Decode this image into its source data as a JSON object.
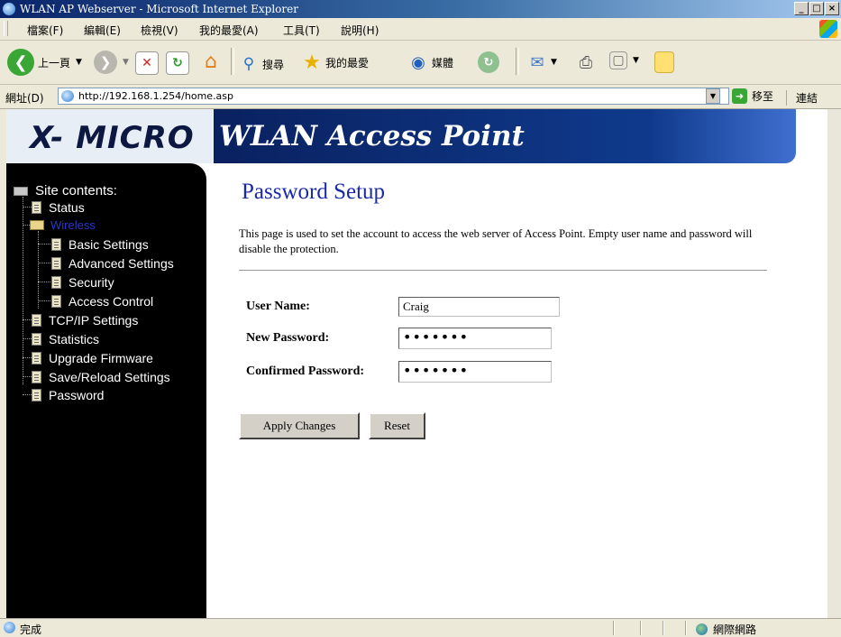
{
  "window": {
    "title": "WLAN AP Webserver - Microsoft Internet Explorer",
    "controls": [
      "_",
      "□",
      "×"
    ]
  },
  "menu": [
    "檔案(F)",
    "編輯(E)",
    "檢視(V)",
    "我的最愛(A)",
    "工具(T)",
    "說明(H)"
  ],
  "toolbar": {
    "back": "上一頁",
    "search": "搜尋",
    "favorites": "我的最愛",
    "media": "媒體"
  },
  "address": {
    "label": "網址(D)",
    "url": "http://192.168.1.254/home.asp",
    "go": "移至",
    "links": "連結"
  },
  "banner": {
    "logo": "X- MICRO",
    "product": "WLAN Access Point"
  },
  "sidebar": {
    "root": "Site contents:",
    "items": [
      {
        "label": "Status"
      },
      {
        "label": "Wireless"
      },
      {
        "label": "Basic Settings"
      },
      {
        "label": "Advanced Settings"
      },
      {
        "label": "Security"
      },
      {
        "label": "Access Control"
      },
      {
        "label": "TCP/IP Settings"
      },
      {
        "label": "Statistics"
      },
      {
        "label": "Upgrade Firmware"
      },
      {
        "label": "Save/Reload Settings"
      },
      {
        "label": "Password"
      }
    ]
  },
  "main": {
    "title": "Password Setup",
    "description": "This page is used to set the account to access the web server of Access Point. Empty user name and password will disable the protection.",
    "fields": {
      "user_name": {
        "label": "User Name:",
        "value": "Craig"
      },
      "new_password": {
        "label": "New Password:",
        "value": "•••••••"
      },
      "confirmed_password": {
        "label": "Confirmed Password:",
        "value": "•••••••"
      }
    },
    "buttons": {
      "apply": "Apply Changes",
      "reset": "Reset"
    }
  },
  "status": {
    "text": "完成",
    "zone": "網際網路"
  }
}
